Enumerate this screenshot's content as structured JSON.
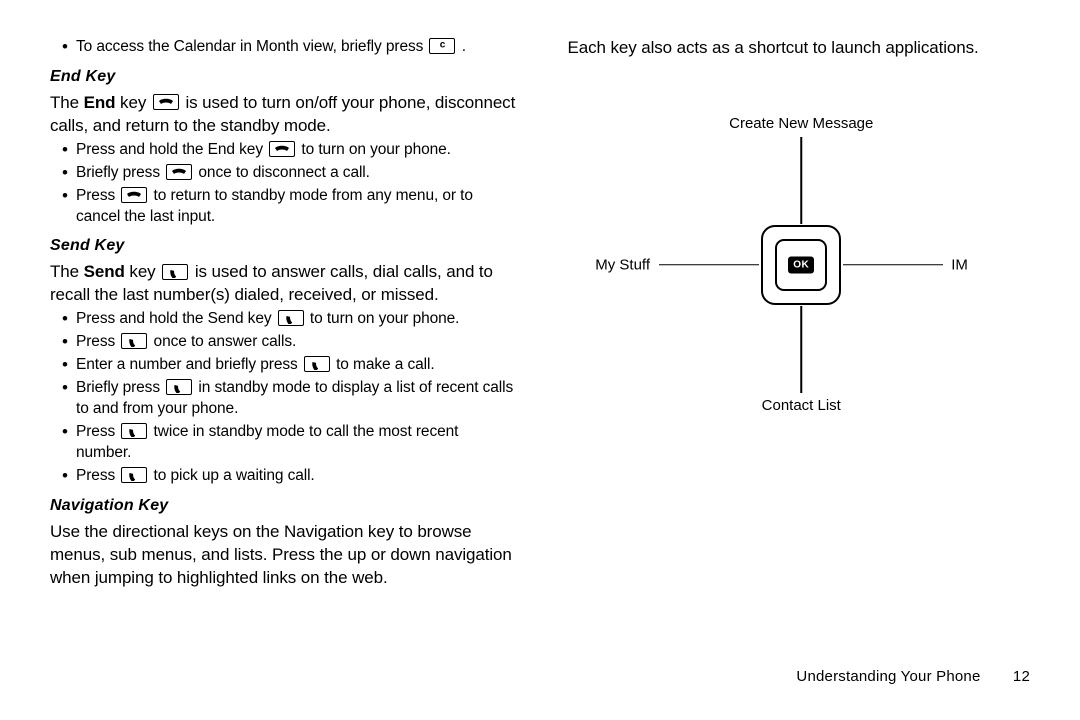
{
  "left": {
    "intro_bullet": {
      "pre": "To access the Calendar in Month view, briefly press ",
      "icon": "c-key",
      "post": " ."
    },
    "end_key": {
      "heading": "End Key",
      "body": {
        "p1a": "The ",
        "p1b": "End",
        "p1c": " key ",
        "p1d": " is used to turn on/off your phone, disconnect calls, and return to the standby mode."
      },
      "bullets": [
        {
          "pre": "Press and hold the End key ",
          "icon": "end",
          "post": " to turn on your phone."
        },
        {
          "pre": "Briefly press ",
          "icon": "end",
          "post": " once to disconnect a call."
        },
        {
          "pre": "Press ",
          "icon": "end",
          "post": " to return to standby mode from any menu, or to cancel the last input."
        }
      ]
    },
    "send_key": {
      "heading": "Send Key",
      "body": {
        "p1a": "The ",
        "p1b": "Send",
        "p1c": " key ",
        "p1d": " is used to answer calls, dial calls, and to recall the last number(s) dialed, received, or missed."
      },
      "bullets": [
        {
          "pre": "Press and hold the Send key ",
          "icon": "send",
          "post": " to turn on your phone."
        },
        {
          "pre": "Press ",
          "icon": "send",
          "post": " once to answer calls."
        },
        {
          "pre": "Enter a number and briefly press ",
          "icon": "send",
          "post": " to make a call."
        },
        {
          "pre": "Briefly press ",
          "icon": "send",
          "post": " in standby mode to display a list of recent calls to and from your phone."
        },
        {
          "pre": "Press ",
          "icon": "send",
          "post": " twice in standby mode to call the most recent number."
        },
        {
          "pre": "Press ",
          "icon": "send",
          "post": " to pick up a waiting call."
        }
      ]
    },
    "nav_key": {
      "heading": "Navigation Key",
      "body": "Use the directional keys on the Navigation key to browse menus, sub menus, and lists. Press the up or down navigation when jumping to highlighted links on the web."
    }
  },
  "right": {
    "intro": "Each key also acts as a shortcut to launch applications.",
    "diagram": {
      "top": "Create New Message",
      "bottom": "Contact List",
      "left": "My Stuff",
      "right": "IM",
      "center": "OK"
    }
  },
  "footer": {
    "section": "Understanding Your Phone",
    "page": "12"
  }
}
